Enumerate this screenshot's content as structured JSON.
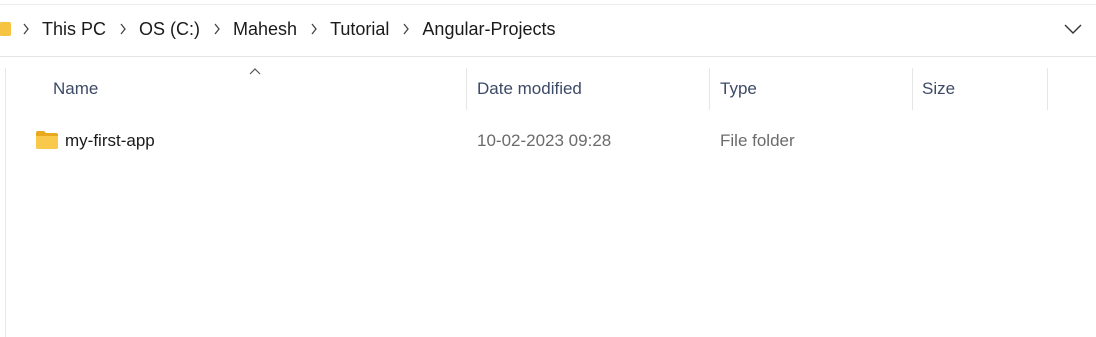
{
  "address_bar": {
    "breadcrumbs": [
      "This PC",
      "OS (C:)",
      "Mahesh",
      "Tutorial",
      "Angular-Projects"
    ]
  },
  "columns": {
    "name": "Name",
    "date_modified": "Date modified",
    "type": "Type",
    "size": "Size"
  },
  "files": [
    {
      "name": "my-first-app",
      "date_modified": "10-02-2023 09:28",
      "type": "File folder",
      "size": ""
    }
  ],
  "colors": {
    "folder": "#f6c342",
    "header_text": "#3d4a66",
    "muted_text": "#6b6b6b"
  }
}
